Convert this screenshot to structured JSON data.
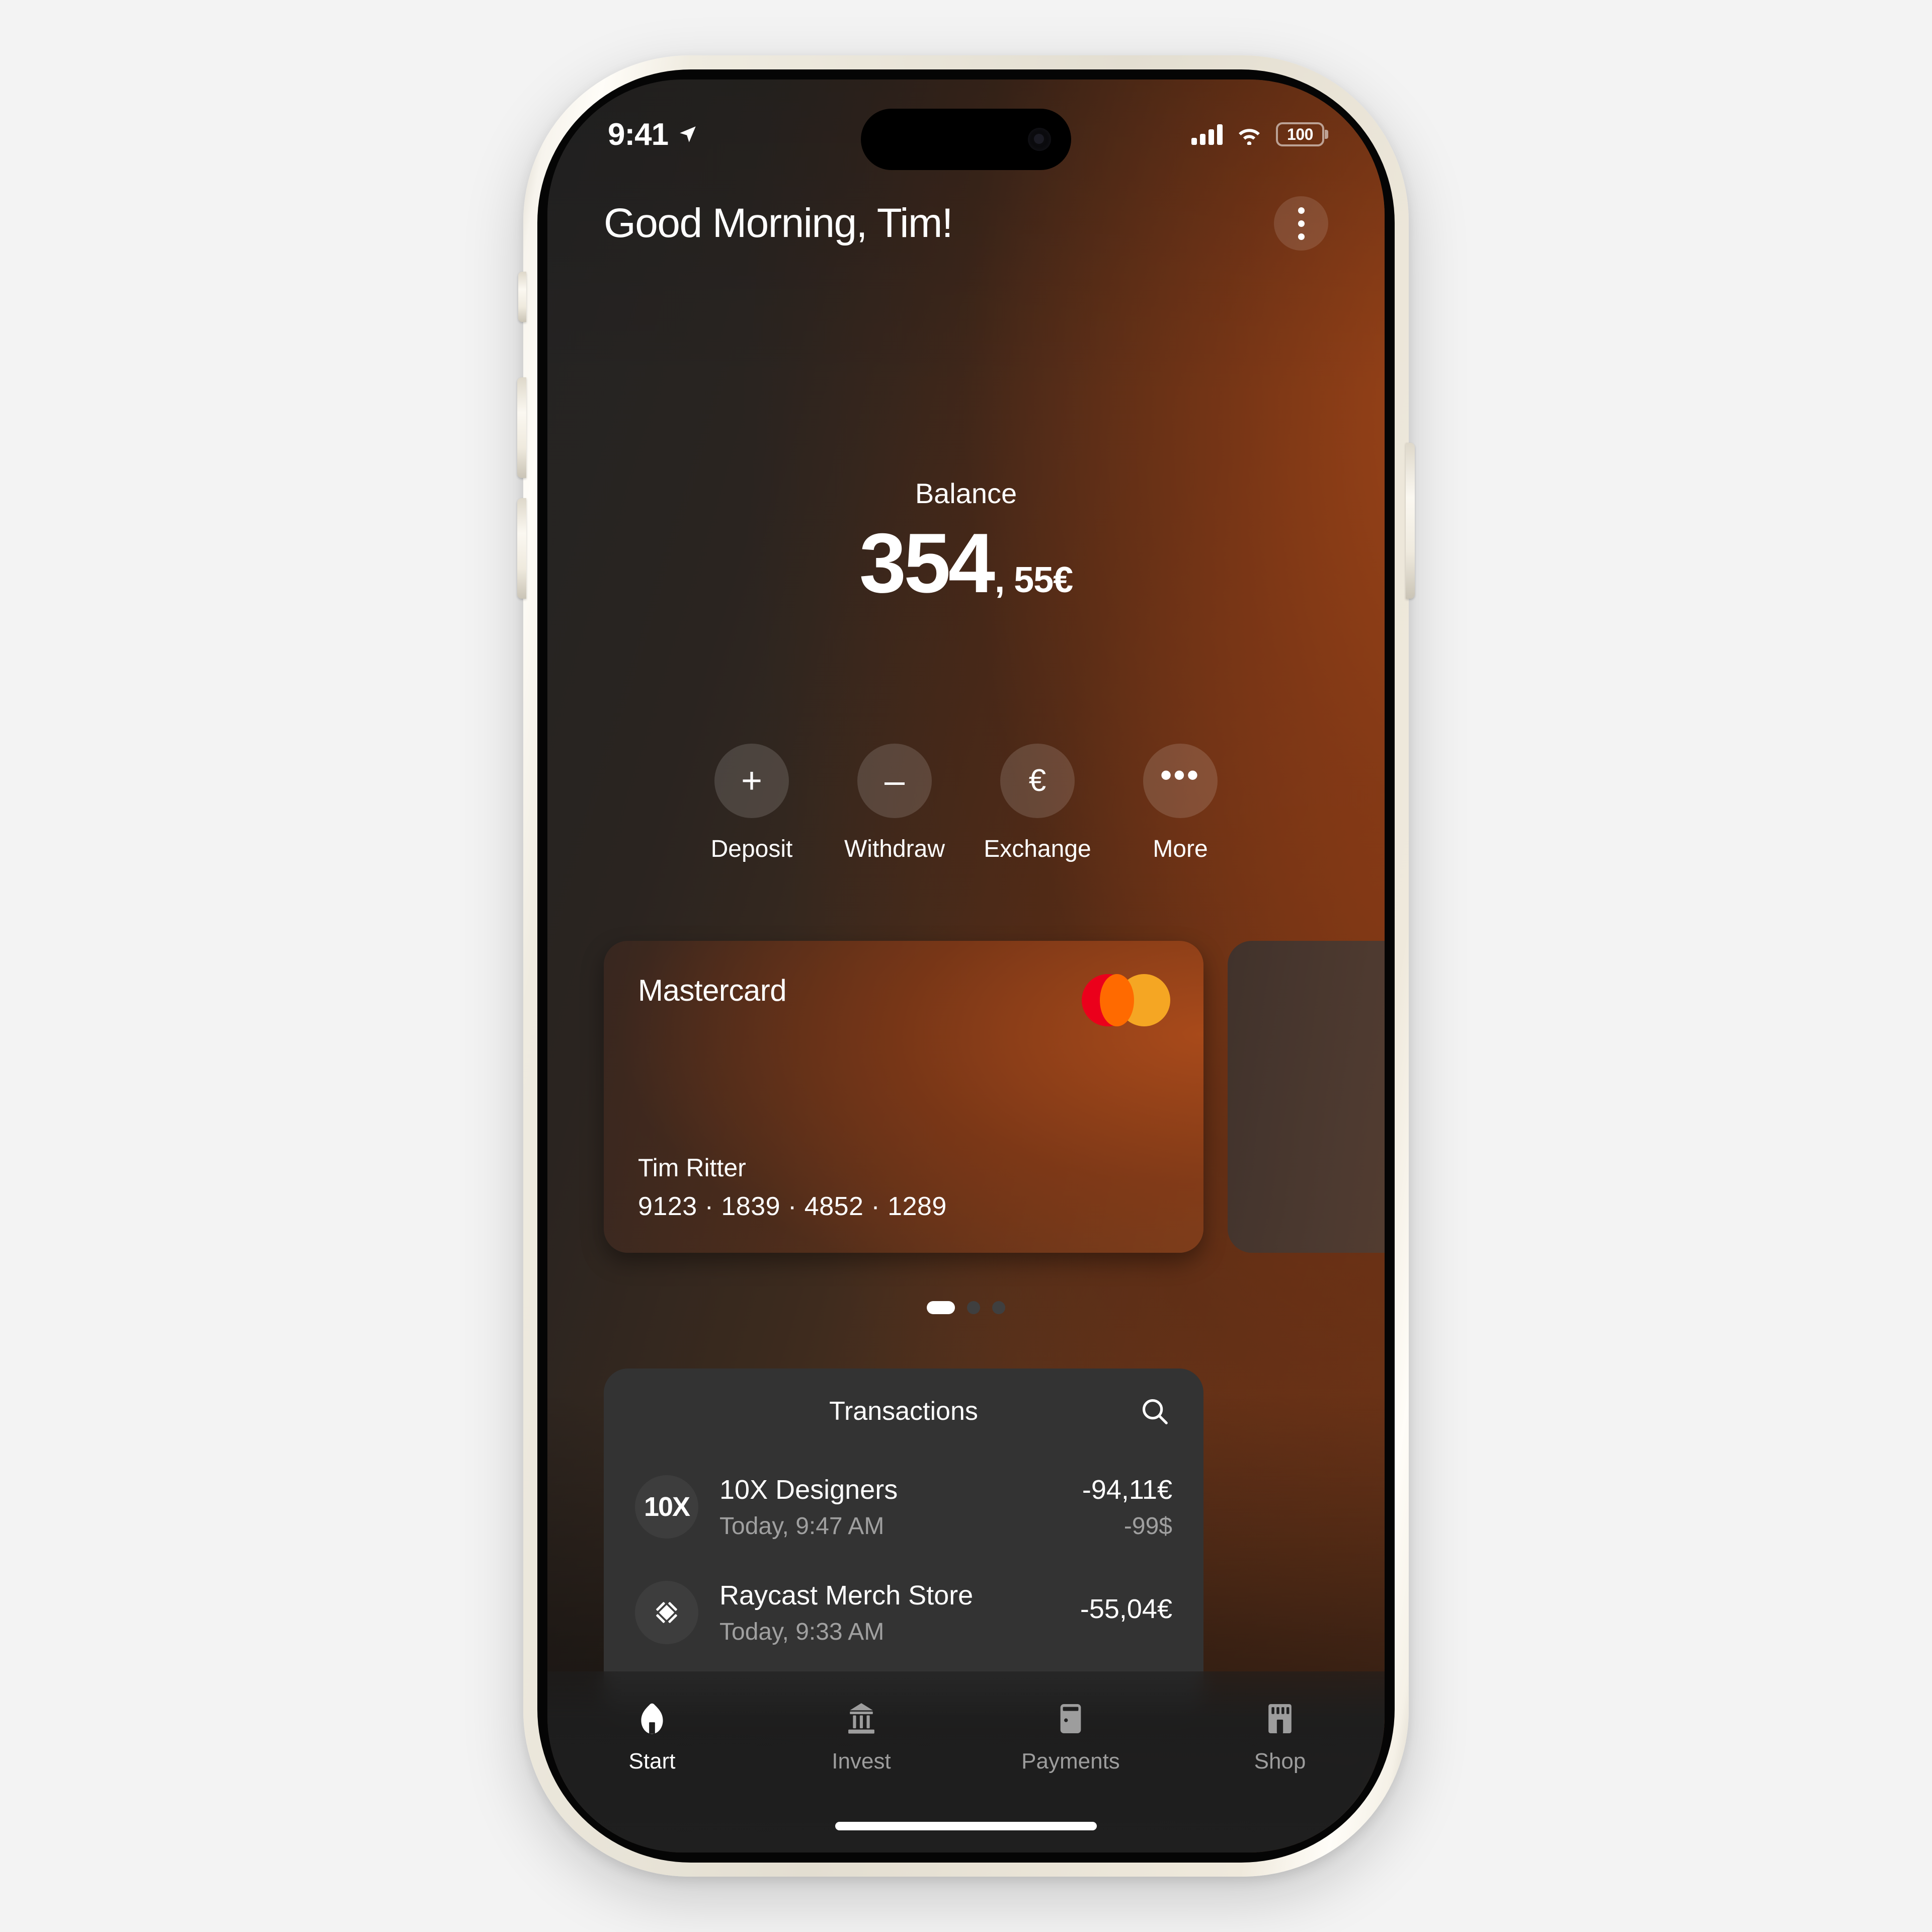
{
  "status_bar": {
    "time": "9:41",
    "location_icon": "location-arrow-icon",
    "cellular_icon": "cellular-bars-icon",
    "wifi_icon": "wifi-icon",
    "battery_level": "100"
  },
  "header": {
    "greeting": "Good Morning, Tim!",
    "menu_icon": "more-vertical-icon"
  },
  "balance": {
    "label": "Balance",
    "integer": "354",
    "decimal": ", 55€"
  },
  "actions": [
    {
      "label": "Deposit",
      "icon": "plus-icon",
      "glyph": "+"
    },
    {
      "label": "Withdraw",
      "icon": "minus-icon",
      "glyph": "–"
    },
    {
      "label": "Exchange",
      "icon": "euro-icon",
      "glyph": "€"
    },
    {
      "label": "More",
      "icon": "ellipsis-icon",
      "glyph": "•••"
    }
  ],
  "cards": {
    "current": {
      "brand": "Mastercard",
      "brand_icon": "mastercard-logo",
      "holder": "Tim Ritter",
      "number": "9123 · 1839 · 4852 · 1289"
    },
    "pager": {
      "total": 3,
      "active_index": 0
    }
  },
  "transactions": {
    "title": "Transactions",
    "search_icon": "search-icon",
    "items": [
      {
        "avatar_text": "10X",
        "avatar_icon": "tenx-logo",
        "name": "10X Designers",
        "time": "Today, 9:47 AM",
        "amount": "-94,11€",
        "secondary_amount": "-99$"
      },
      {
        "avatar_text": "",
        "avatar_icon": "raycast-logo",
        "name": "Raycast Merch Store",
        "time": "Today, 9:33 AM",
        "amount": "-55,04€",
        "secondary_amount": ""
      }
    ]
  },
  "tabbar": {
    "items": [
      {
        "label": "Start",
        "icon": "home-icon",
        "active": true
      },
      {
        "label": "Invest",
        "icon": "bank-icon",
        "active": false
      },
      {
        "label": "Payments",
        "icon": "card-icon",
        "active": false
      },
      {
        "label": "Shop",
        "icon": "store-icon",
        "active": false
      }
    ]
  },
  "colors": {
    "accent_warm": "#8a4720",
    "mastercard_red": "#eb001b",
    "mastercard_yellow": "#f5a623",
    "mastercard_overlap": "#ff6a00",
    "panel": "#333333",
    "muted_text": "#a0a0a0"
  }
}
